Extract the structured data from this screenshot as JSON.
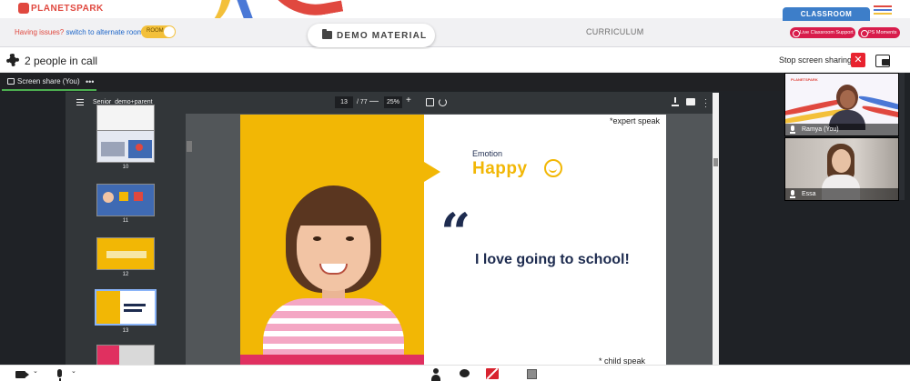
{
  "brand": {
    "logo_text": "PLANETSPARK"
  },
  "header": {
    "issue_prefix": "Having issues?",
    "issue_link": "switch to alternate room",
    "room_toggle_label": "ROOM",
    "demo_material": "DEMO MATERIAL",
    "curriculum": "CURRICULUM",
    "classroom_tab": "CLASSROOM",
    "live_support": "Live Classroom Support",
    "ps_moments": "PS Moments"
  },
  "call": {
    "people_count": "2 people in call",
    "stop_sharing": "Stop screen sharing"
  },
  "share_tab": {
    "label": "Screen share (You)",
    "more": "•••"
  },
  "pdf": {
    "title": "Senior_demo+parent",
    "current_page": "13",
    "page_sep": "/ 77",
    "zoom": "25%",
    "thumbnails": [
      {
        "num": "10"
      },
      {
        "num": "11"
      },
      {
        "num": "12"
      },
      {
        "num": "13"
      }
    ]
  },
  "slide": {
    "expert_note": "*expert speak",
    "emotion_label": "Emotion",
    "emotion_value": "Happy",
    "quote": "I love going to school!",
    "child_note": "* child speak"
  },
  "participants": [
    {
      "name": "Ramya (You)"
    },
    {
      "name": "Essa"
    }
  ],
  "colors": {
    "accent_red": "#d81c4b",
    "classroom_blue": "#3d7ec9",
    "slide_yellow": "#f2b705",
    "share_green": "#4caf50"
  }
}
